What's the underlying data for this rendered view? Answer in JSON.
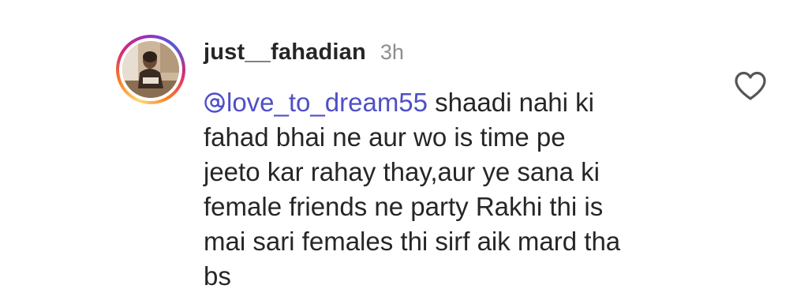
{
  "comment": {
    "username": "just__fahadian",
    "time": "3h",
    "mention": "love_to_dream55",
    "lines": [
      " shaadi nahi ki",
      "fahad bhai ne aur wo is time pe",
      "jeeto kar rahay thay,aur ye sana ki",
      "female friends ne party Rakhi thi is",
      "mai sari females thi sirf aik mard tha",
      "bs"
    ],
    "avatar": "profile-photo",
    "like_icon": "heart-outline-icon",
    "mention_color": "#4f4fc8",
    "text_color": "#262626",
    "time_color": "#8e8e8e"
  }
}
